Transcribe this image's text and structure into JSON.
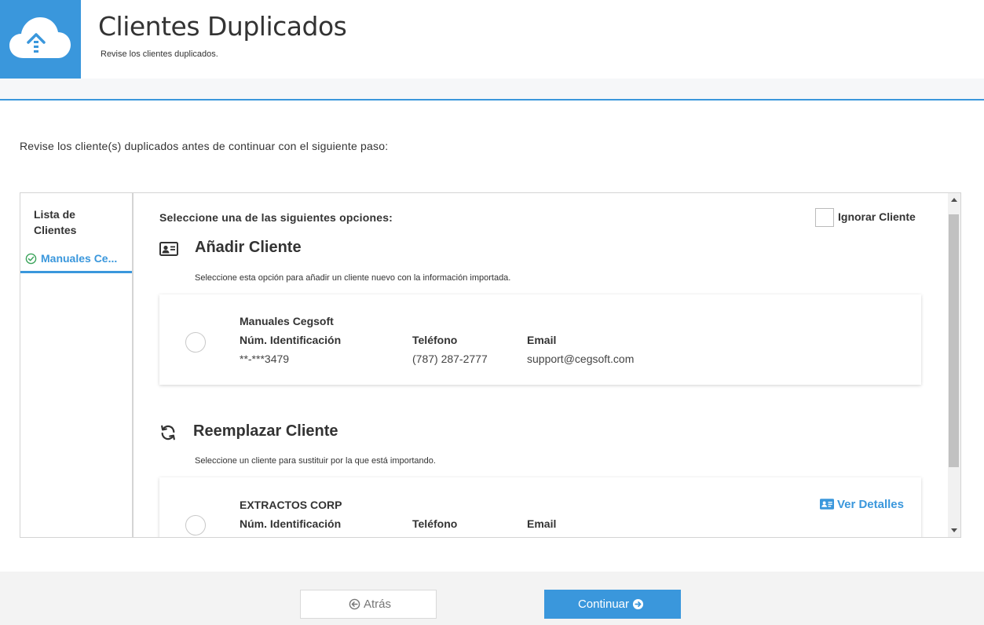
{
  "header": {
    "title": "Clientes Duplicados",
    "subtitle": "Revise los clientes duplicados.",
    "logo_icon": "cloud-upload-icon",
    "accent_color": "#3a97dc"
  },
  "intro_text": "Revise los cliente(s) duplicados antes de continuar con el siguiente paso:",
  "sidebar": {
    "title": "Lista de Clientes",
    "items": [
      {
        "label": "Manuales Ce...",
        "icon": "check-circle-icon",
        "selected": true
      }
    ]
  },
  "main": {
    "prompt": "Seleccione una de las siguientes opciones:",
    "ignore_label": "Ignorar Cliente",
    "add_section": {
      "title": "Añadir Cliente",
      "description": "Seleccione esta opción para añadir un cliente nuevo con la información importada.",
      "icon": "id-card-icon",
      "card": {
        "name": "Manuales Cegsoft",
        "id_label": "Núm. Identificación",
        "id_value": "**-***3479",
        "phone_label": "Teléfono",
        "phone_value": "(787) 287-2777",
        "email_label": "Email",
        "email_value": "support@cegsoft.com"
      }
    },
    "replace_section": {
      "title": "Reemplazar Cliente",
      "description": "Seleccione un cliente para sustituir por la que está importando.",
      "icon": "refresh-icon",
      "card": {
        "name": "EXTRACTOS CORP",
        "id_label": "Núm. Identificación",
        "phone_label": "Teléfono",
        "email_label": "Email",
        "details_label": "Ver Detalles"
      }
    }
  },
  "footer": {
    "back_label": "Atrás",
    "next_label": "Continuar"
  }
}
